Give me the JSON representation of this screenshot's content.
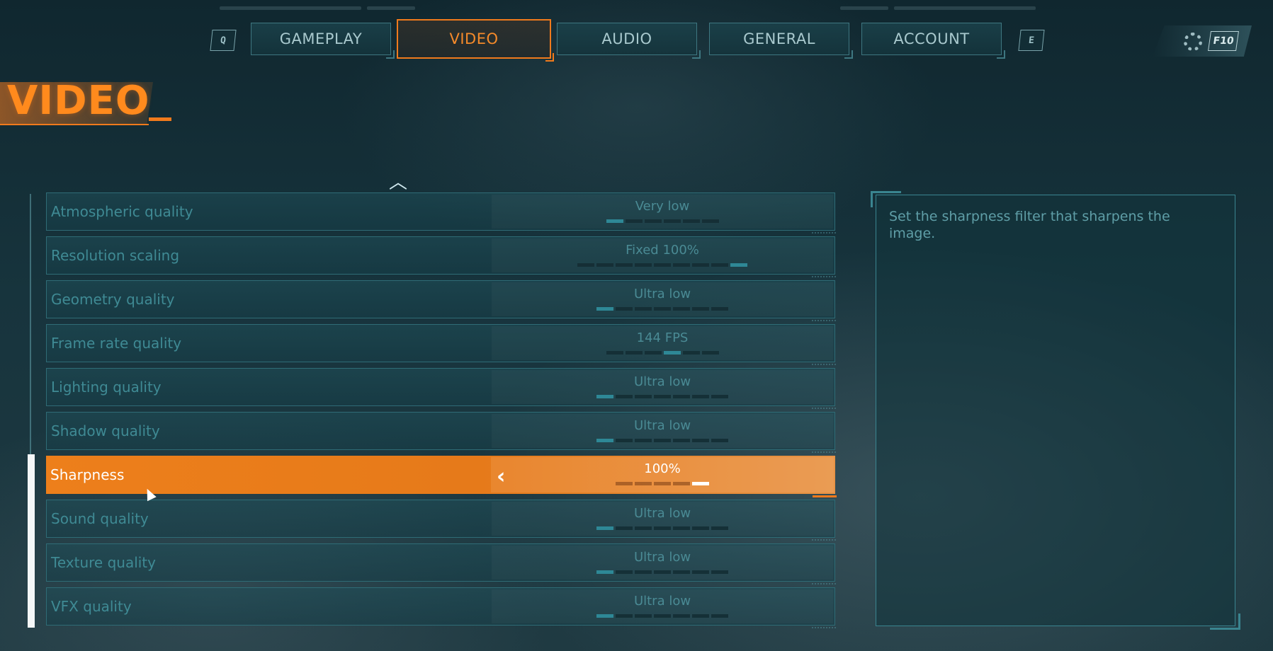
{
  "tabs": {
    "prev_key": "Q",
    "next_key": "E",
    "items": [
      {
        "label": "GAMEPLAY",
        "active": false
      },
      {
        "label": "VIDEO",
        "active": true
      },
      {
        "label": "AUDIO",
        "active": false
      },
      {
        "label": "GENERAL",
        "active": false
      },
      {
        "label": "ACCOUNT",
        "active": false
      }
    ],
    "settings_key": "F10"
  },
  "page": {
    "title": "VIDEO"
  },
  "settings": [
    {
      "label": "Atmospheric quality",
      "value": "Very low",
      "pips_total": 6,
      "pips_on": 1
    },
    {
      "label": "Resolution scaling",
      "value": "Fixed 100%",
      "pips_total": 9,
      "pips_on": 1,
      "pips_on_index": 8
    },
    {
      "label": "Geometry quality",
      "value": "Ultra low",
      "pips_total": 7,
      "pips_on": 1
    },
    {
      "label": "Frame rate quality",
      "value": "144 FPS",
      "pips_total": 6,
      "pips_on": 1,
      "pips_on_index": 3
    },
    {
      "label": "Lighting quality",
      "value": "Ultra low",
      "pips_total": 7,
      "pips_on": 1
    },
    {
      "label": "Shadow quality",
      "value": "Ultra low",
      "pips_total": 7,
      "pips_on": 1
    },
    {
      "label": "Sharpness",
      "value": "100%",
      "pips_total": 5,
      "pips_on": 1,
      "pips_on_index": 4,
      "selected": true
    },
    {
      "label": "Sound quality",
      "value": "Ultra low",
      "pips_total": 7,
      "pips_on": 1
    },
    {
      "label": "Texture quality",
      "value": "Ultra low",
      "pips_total": 7,
      "pips_on": 1
    },
    {
      "label": "VFX quality",
      "value": "Ultra low",
      "pips_total": 7,
      "pips_on": 1
    }
  ],
  "description": {
    "text": "Set the sharpness filter that sharpens the image."
  },
  "colors": {
    "accent": "#f07a1c",
    "frame": "#3a8590",
    "text_dim": "#3f8a94"
  },
  "icons": {
    "settings": "gear-icon",
    "scroll_up": "chevron-up-icon",
    "value_prev": "chevron-left-icon"
  }
}
